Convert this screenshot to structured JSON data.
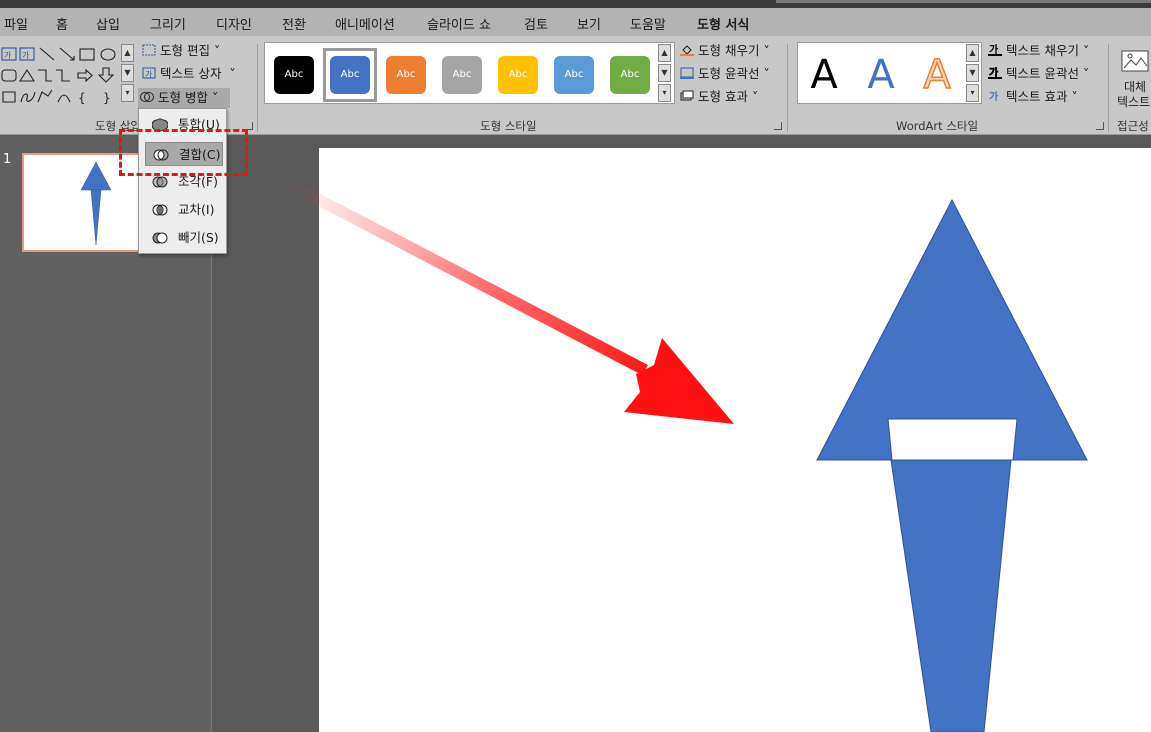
{
  "menu": {
    "tabs": [
      "파일",
      "홈",
      "삽입",
      "그리기",
      "디자인",
      "전환",
      "애니메이션",
      "슬라이드 쇼",
      "검토",
      "보기",
      "도움말",
      "도형 서식"
    ],
    "active_tab": "도형 서식"
  },
  "ribbon": {
    "insert_shapes": {
      "label": "도형 삽입",
      "edit_shape": "도형 편집",
      "text_box": "텍스트 상자",
      "merge_shapes": "도형 병합"
    },
    "shape_styles": {
      "label": "도형 스타일",
      "swatches": [
        {
          "text": "Abc",
          "color": "#000000"
        },
        {
          "text": "Abc",
          "color": "#4472c4"
        },
        {
          "text": "Abc",
          "color": "#ed7d31"
        },
        {
          "text": "Abc",
          "color": "#a5a5a5"
        },
        {
          "text": "Abc",
          "color": "#ffc000"
        },
        {
          "text": "Abc",
          "color": "#5b9bd5"
        },
        {
          "text": "Abc",
          "color": "#70ad47"
        }
      ],
      "shape_fill": "도형 채우기",
      "shape_outline": "도형 윤곽선",
      "shape_effects": "도형 효과"
    },
    "wordart": {
      "label": "WordArt 스타일",
      "letters": [
        "A",
        "A",
        "A"
      ],
      "text_fill": "텍스트 채우기",
      "text_outline": "텍스트 윤곽선",
      "text_effects": "텍스트 효과"
    },
    "accessibility": {
      "alt_text_line1": "대체",
      "alt_text_line2": "텍스트",
      "label": "접근성"
    }
  },
  "merge_menu": {
    "items": [
      {
        "label": "통합(U)",
        "icon": "union-icon"
      },
      {
        "label": "결합(C)",
        "icon": "combine-icon"
      },
      {
        "label": "조각(F)",
        "icon": "fragment-icon"
      },
      {
        "label": "교차(I)",
        "icon": "intersect-icon"
      },
      {
        "label": "빼기(S)",
        "icon": "subtract-icon"
      }
    ],
    "highlighted": "결합(C)"
  },
  "slides": {
    "current_number": "1"
  },
  "colors": {
    "shape_blue": "#4472c4",
    "highlight_red": "#e31616",
    "ribbon_bg": "#c8c8c8"
  }
}
